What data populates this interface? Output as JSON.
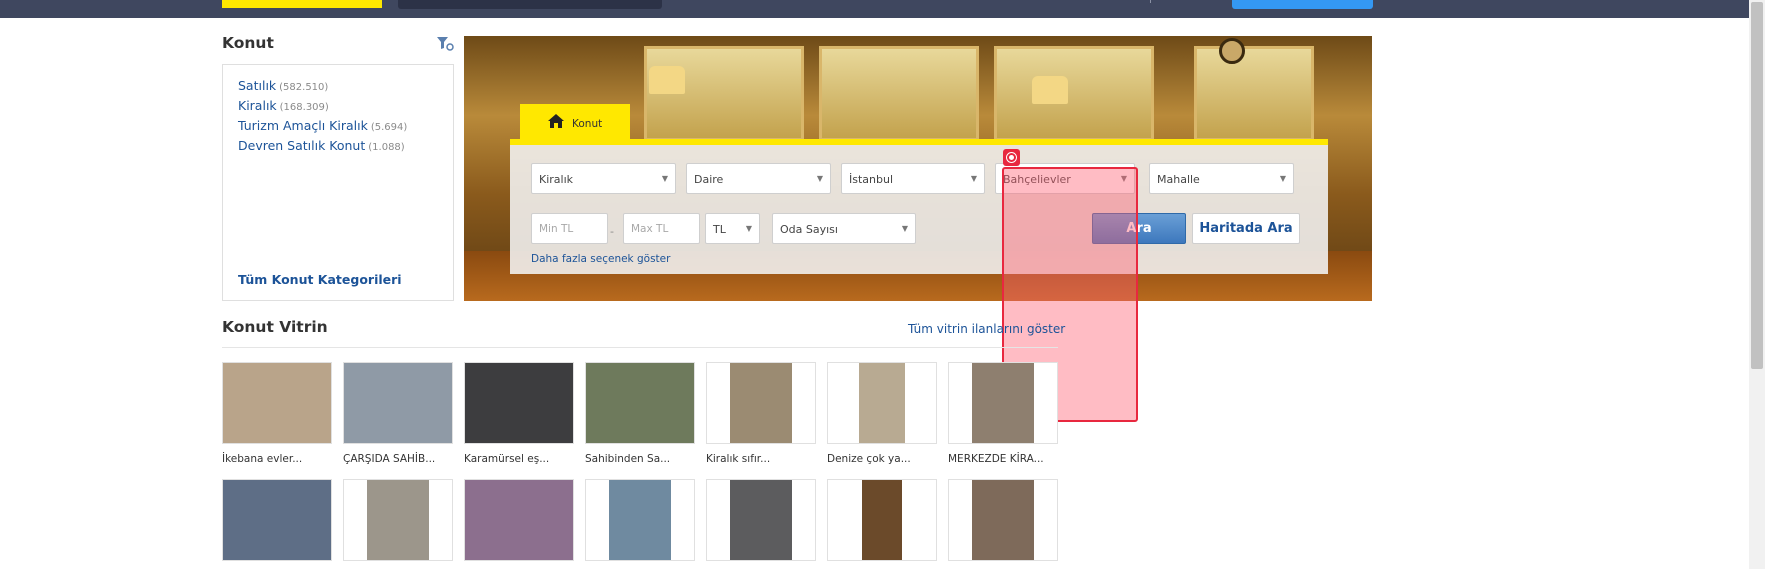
{
  "sidebar": {
    "title": "Konut",
    "items": [
      {
        "label": "Satılık",
        "count": "(582.510)"
      },
      {
        "label": "Kiralık",
        "count": "(168.309)"
      },
      {
        "label": "Turizm Amaçlı Kiralık",
        "count": "(5.694)"
      },
      {
        "label": "Devren Satılık Konut",
        "count": "(1.088)"
      }
    ],
    "all_categories": "Tüm Konut Kategorileri"
  },
  "search": {
    "tab_label": "Konut",
    "filters": {
      "type": "Kiralık",
      "subtype": "Daire",
      "city": "İstanbul",
      "district": "Bahçelievler",
      "neighborhood": "Mahalle"
    },
    "min_price_placeholder": "Min TL",
    "max_price_placeholder": "Max TL",
    "currency": "TL",
    "rooms": "Oda Sayısı",
    "search_button": "Ara",
    "map_button": "Haritada Ara",
    "more_options": "Daha fazla seçenek göster"
  },
  "vitrin": {
    "title": "Konut Vitrin",
    "show_all": "Tüm vitrin ilanlarını göster",
    "row1": [
      {
        "title": "İkebana evler...",
        "photo_color": "#b9a48a"
      },
      {
        "title": "ÇARŞIDA SAHİB...",
        "photo_color": "#8f9aa6"
      },
      {
        "title": "Karamürsel eş...",
        "photo_color": "#3d3d3f"
      },
      {
        "title": "Sahibinden Sa...",
        "photo_color": "#6e7a5c"
      },
      {
        "title": "Kiralık sıfır...",
        "photo_color": "#9b8b72"
      },
      {
        "title": "Denize çok ya...",
        "photo_color": "#b8aa92"
      },
      {
        "title": "MERKEZDE KİRA...",
        "photo_color": "#8e7f6f"
      }
    ],
    "row2": [
      {
        "photo_color": "#5e6e86"
      },
      {
        "photo_color": "#9c968b"
      },
      {
        "photo_color": "#8c6f8e"
      },
      {
        "photo_color": "#6f8aa0"
      },
      {
        "photo_color": "#5c5c5e"
      },
      {
        "photo_color": "#6b4a2a"
      },
      {
        "photo_color": "#7e6a5a"
      }
    ]
  },
  "colors": {
    "accent": "#ffe800",
    "link": "#1c5398",
    "topbar": "#3f475f",
    "highlight": "#e8283f"
  }
}
